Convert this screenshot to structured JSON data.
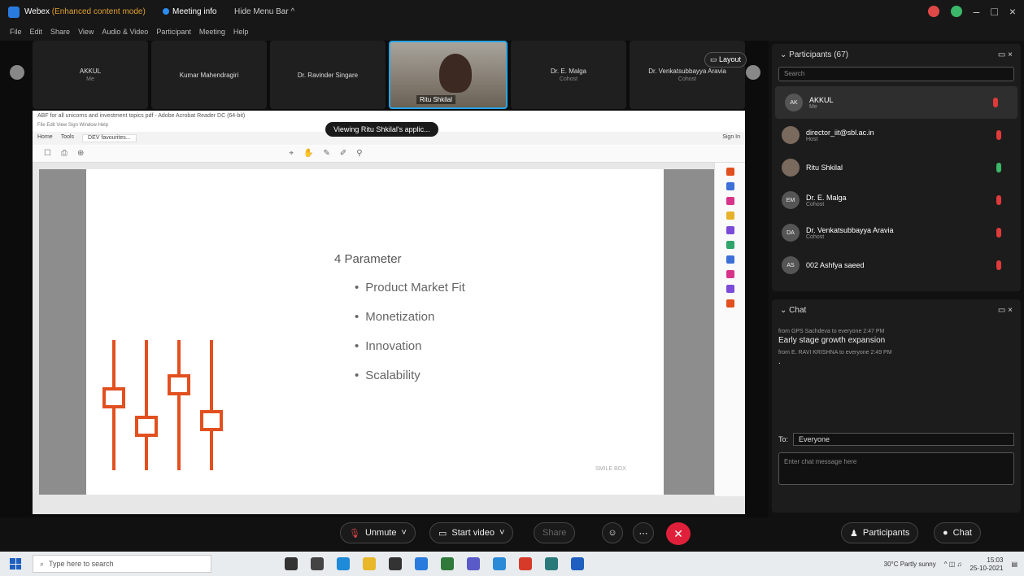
{
  "window": {
    "app_title": "Webex",
    "mode": "(Enhanced content mode)",
    "meeting_info": "Meeting info",
    "hide_menu": "Hide Menu Bar ^",
    "menu": [
      "File",
      "Edit",
      "Share",
      "View",
      "Audio & Video",
      "Participant",
      "Meeting",
      "Help"
    ]
  },
  "filmstrip": [
    {
      "name": "AKKUL",
      "sub": "Me"
    },
    {
      "name": "Kumar Mahendragiri",
      "sub": ""
    },
    {
      "name": "Dr. Ravinder Singare",
      "sub": ""
    },
    {
      "name": "Ritu Shkilal",
      "sub": "",
      "active": true
    },
    {
      "name": "Dr. E. Malga",
      "sub": "Cohost"
    },
    {
      "name": "Dr. Venkatsubbayya Aravia",
      "sub": "Cohost"
    }
  ],
  "layout_label": "Layout",
  "viewing_banner": "Viewing Ritu Shkilal's applic...",
  "acrobat": {
    "title": "ABF for all unicorns and investment topics pdf - Adobe Acrobat Reader DC (64-bit)",
    "menu": "File  Edit  View  Sign  Window  Help",
    "tabs": [
      "Home",
      "Tools",
      "DEV favourites..."
    ],
    "sign_in": "Sign In"
  },
  "slide": {
    "heading": "4 Parameter",
    "bullets": [
      "Product Market Fit",
      "Monetization",
      "Innovation",
      "Scalability"
    ],
    "footer": "SMILE BOX"
  },
  "controls": {
    "unmute": "Unmute",
    "start_video": "Start video",
    "share": "Share",
    "participants": "Participants",
    "chat": "Chat"
  },
  "participants_panel": {
    "title": "Participants (67)",
    "search_placeholder": "Search",
    "people": [
      {
        "name": "AKKUL",
        "role": "Me",
        "initials": "AK",
        "mic": "red"
      },
      {
        "name": "director_iit@sbl.ac.in",
        "role": "Host",
        "initials": "",
        "mic": "red"
      },
      {
        "name": "Ritu Shkilal",
        "role": "",
        "initials": "",
        "mic": "green"
      },
      {
        "name": "Dr. E. Malga",
        "role": "Cohost",
        "initials": "EM",
        "mic": "red"
      },
      {
        "name": "Dr. Venkatsubbayya Aravia",
        "role": "Cohost",
        "initials": "DA",
        "mic": "red"
      },
      {
        "name": "002 Ashfya saeed",
        "role": "",
        "initials": "AS",
        "mic": "red"
      }
    ]
  },
  "chat_panel": {
    "title": "Chat",
    "messages": [
      {
        "meta": "from GPS Sachdeva to everyone  2:47 PM",
        "text": "Early stage growth expansion"
      },
      {
        "meta": "from E. RAVI KRISHNA to everyone  2:49 PM",
        "text": "."
      }
    ],
    "to_label": "To:",
    "to_value": "Everyone",
    "input_placeholder": "Enter chat message here"
  },
  "taskbar": {
    "search_placeholder": "Type here to search",
    "weather": "30°C Partly sunny",
    "time": "15:03",
    "date": "25-10-2021"
  }
}
